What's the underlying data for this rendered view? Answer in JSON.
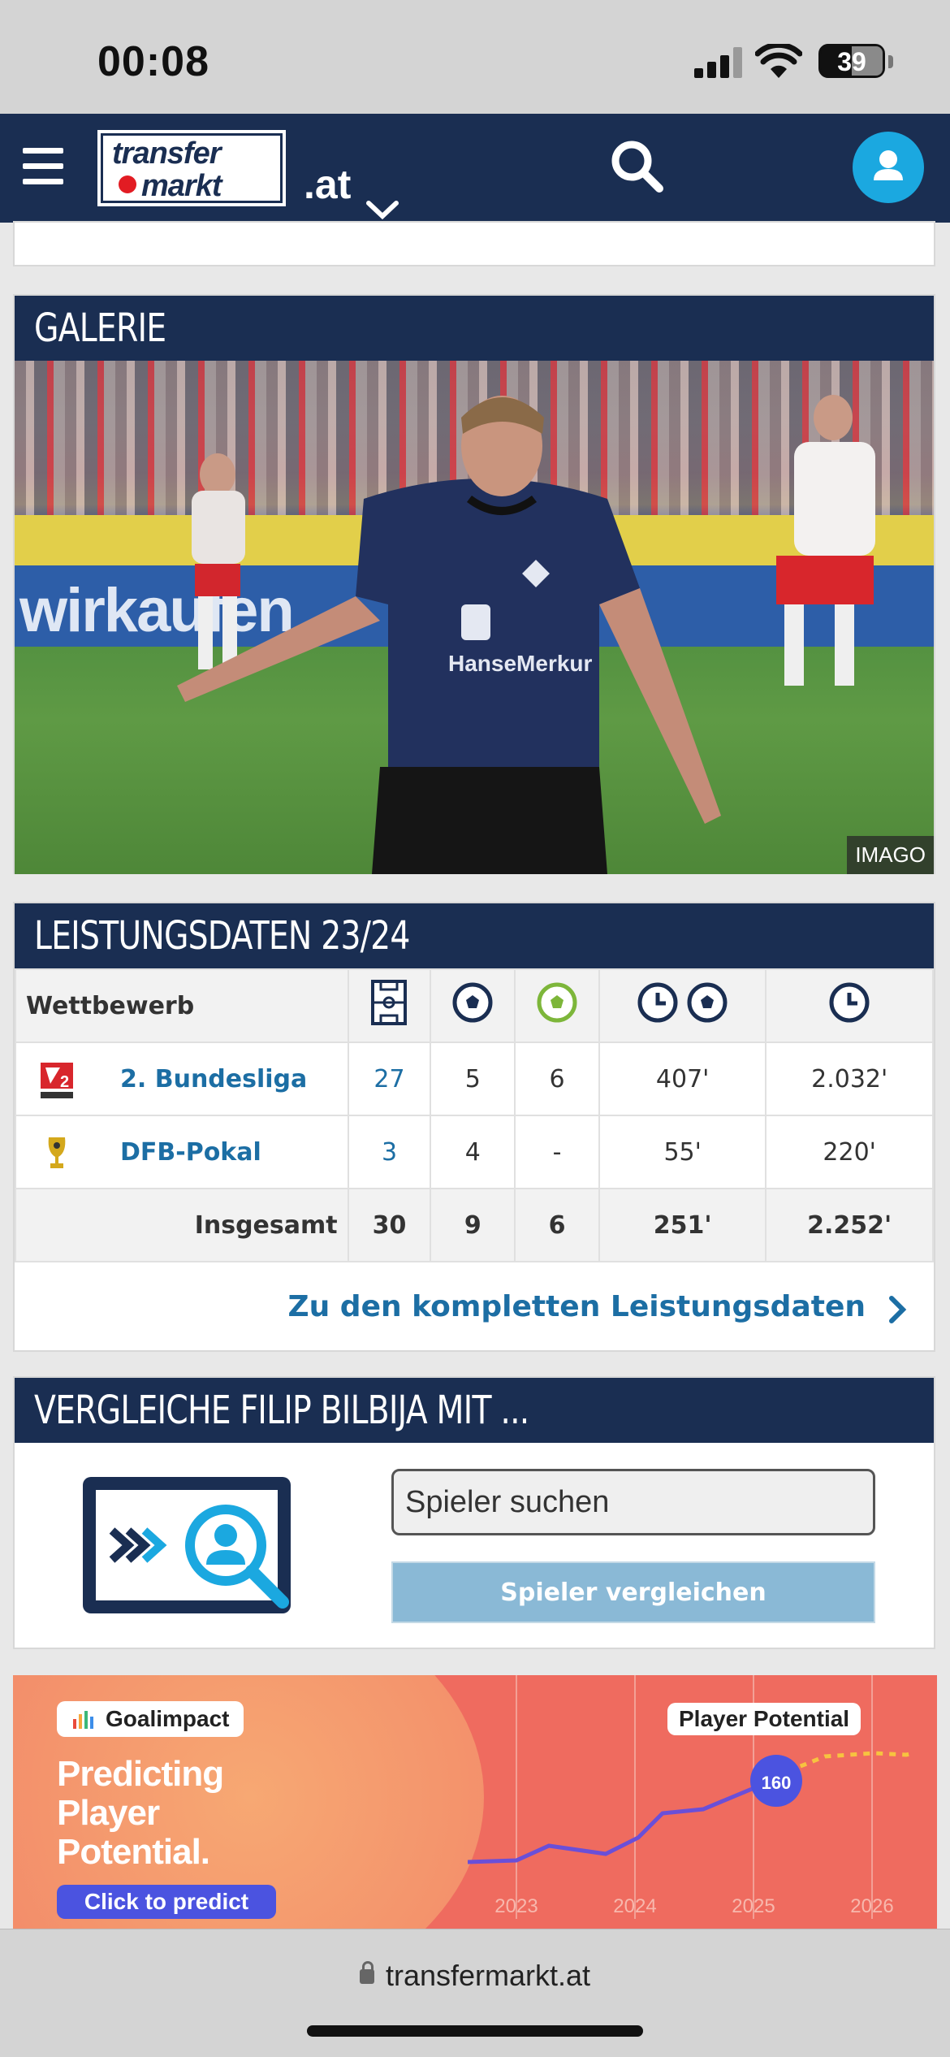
{
  "status": {
    "time": "00:08",
    "battery": "39"
  },
  "header": {
    "logo_line1": "transfer",
    "logo_line2": "markt",
    "domain": ".at"
  },
  "gallery": {
    "title": "GALERIE",
    "credit": "IMAGO",
    "banner_text": "wirkaufen"
  },
  "stats": {
    "title": "LEISTUNGSDATEN 23/24",
    "col_competition": "Wettbewerb",
    "rows": [
      {
        "competition": "2. Bundesliga",
        "apps": "27",
        "goals": "5",
        "assists": "6",
        "min_per_goal": "407'",
        "minutes": "2.032'"
      },
      {
        "competition": "DFB-Pokal",
        "apps": "3",
        "goals": "4",
        "assists": "-",
        "min_per_goal": "55'",
        "minutes": "220'"
      }
    ],
    "total": {
      "label": "Insgesamt",
      "apps": "30",
      "goals": "9",
      "assists": "6",
      "min_per_goal": "251'",
      "minutes": "2.252'"
    },
    "more_link": "Zu den kompletten Leistungsdaten"
  },
  "compare": {
    "title": "VERGLEICHE FILIP BILBIJA MIT ...",
    "search_placeholder": "Spieler suchen",
    "button": "Spieler vergleichen"
  },
  "ad": {
    "brand": "Goalimpact",
    "headline": "Predicting Player Potential.",
    "cta": "Click to predict",
    "chart_label": "Player Potential",
    "value": "160",
    "years": [
      "2023",
      "2024",
      "2025",
      "2026"
    ]
  },
  "browser": {
    "url": "transfermarkt.at"
  },
  "colors": {
    "navy": "#1a2e52",
    "link": "#1c6ea4",
    "accent": "#1ba8e0"
  }
}
